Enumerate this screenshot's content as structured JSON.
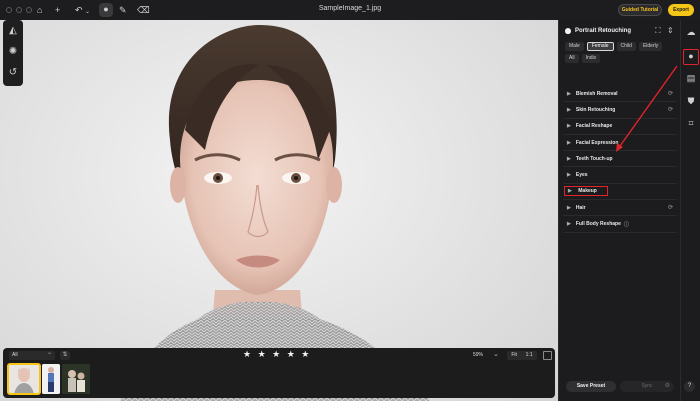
{
  "titlebar": {
    "filename": "SampleImage_1.jpg",
    "guided_label": "Guided Tutorial",
    "export_label": "Export"
  },
  "filmstrip": {
    "filter_value": "All",
    "rating_stars": "★ ★ ★ ★ ★",
    "zoom": "59%",
    "fit_label": "Fit",
    "one_to_one_label": "1:1"
  },
  "panel": {
    "title": "Portrait Retouching",
    "chips": [
      "Male",
      "Female",
      "Child",
      "Elderly",
      "All",
      "Indix"
    ],
    "active_chip": "Female",
    "sections": [
      "Blemish Removal",
      "Skin Retouching",
      "Facial Reshape",
      "Facial Expression",
      "Teeth Touch-up",
      "Eyes",
      "Makeup",
      "Hair",
      "Full Body Reshape"
    ],
    "highlighted_section": "Makeup",
    "save_preset_label": "Save Preset",
    "sync_label": "Sync"
  },
  "colors": {
    "accent": "#f5c518",
    "annotation_red": "#e0242a",
    "panel_bg": "#1c1c1e"
  },
  "icons": {
    "toolbar": [
      "home-icon",
      "plus-icon",
      "undo-icon",
      "portrait-mode-icon",
      "brush-icon",
      "eraser-icon"
    ],
    "left_tools": [
      "ai-enhance-icon",
      "adjust-icon",
      "history-icon"
    ],
    "rail": [
      "preset-icon",
      "portrait-icon",
      "background-icon",
      "clothing-icon",
      "crop-icon"
    ]
  }
}
